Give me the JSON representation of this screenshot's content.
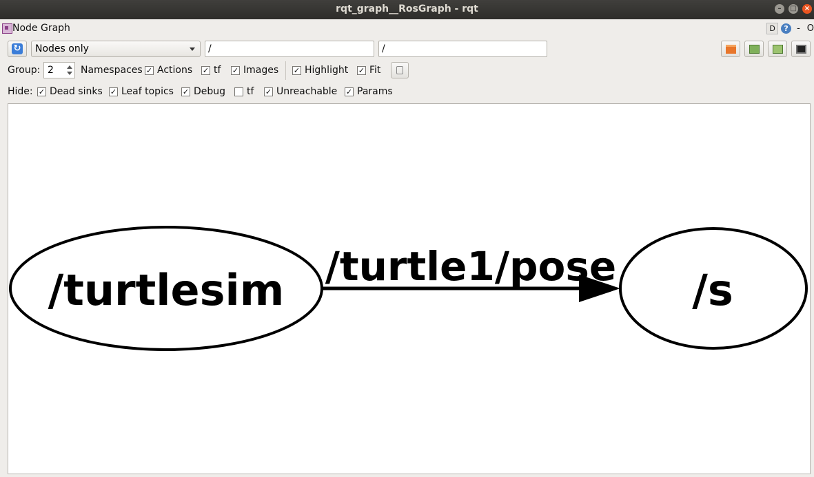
{
  "window": {
    "title": "rqt_graph__RosGraph - rqt",
    "controls": [
      "minimize",
      "maximize",
      "close"
    ]
  },
  "dock": {
    "title": "Node Graph",
    "d_label": "D",
    "help_label": "?",
    "dash": "-",
    "o": "O"
  },
  "toolbar": {
    "filter_mode": "Nodes only",
    "node_filter": "/",
    "topic_filter": "/",
    "icons": [
      "refresh-icon",
      "folder-icon",
      "save-dot-icon",
      "save-image-icon",
      "screenshot-icon"
    ]
  },
  "options": {
    "group_label": "Group:",
    "group_value": "2",
    "namespaces_label": "Namespaces",
    "items": [
      {
        "label": "Actions",
        "checked": true
      },
      {
        "label": "tf",
        "checked": true
      },
      {
        "label": "Images",
        "checked": true
      },
      {
        "label": "Highlight",
        "checked": true
      },
      {
        "label": "Fit",
        "checked": true
      }
    ]
  },
  "hide": {
    "label": "Hide:",
    "items": [
      {
        "label": "Dead sinks",
        "checked": true
      },
      {
        "label": "Leaf topics",
        "checked": true
      },
      {
        "label": "Debug",
        "checked": true
      },
      {
        "label": "tf",
        "checked": false
      },
      {
        "label": "Unreachable",
        "checked": true
      },
      {
        "label": "Params",
        "checked": true
      }
    ]
  },
  "graph": {
    "nodes": [
      {
        "name": "/turtlesim"
      },
      {
        "name": "/s"
      }
    ],
    "edges": [
      {
        "from": "/turtlesim",
        "to": "/s",
        "topic": "/turtle1/pose"
      }
    ]
  },
  "colors": {
    "titlebar": "#2e2d2a",
    "close_button": "#e95420",
    "accent": "#3b7dd8"
  }
}
